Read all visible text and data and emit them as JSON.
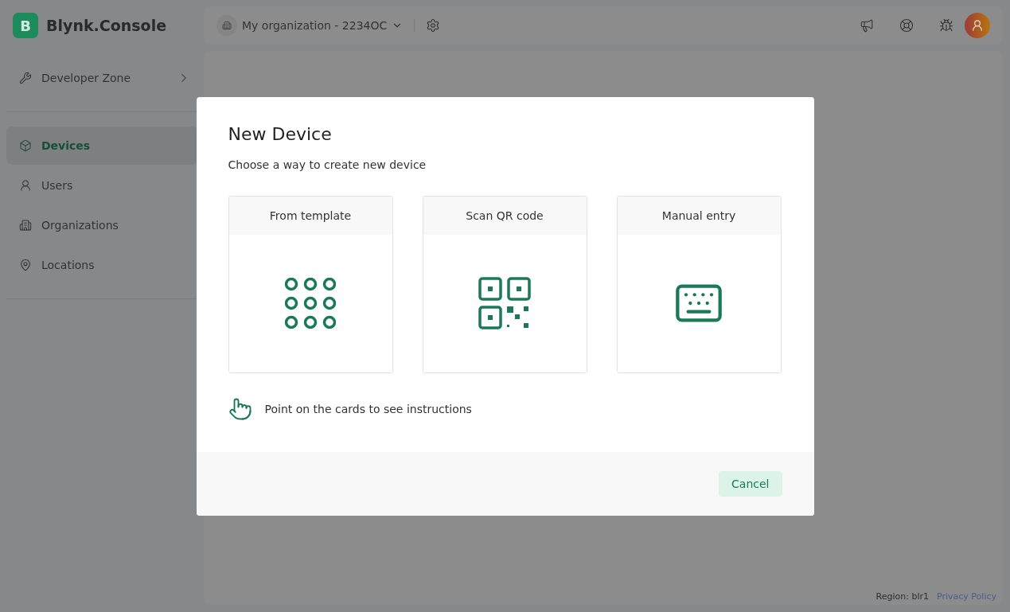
{
  "brand": {
    "logo_letter": "B",
    "name": "Blynk.Console"
  },
  "topbar": {
    "organization": "My organization - 2234OC"
  },
  "sidebar": {
    "developer_zone": "Developer Zone",
    "items": [
      {
        "label": "Devices",
        "kind": "devices",
        "selected": true
      },
      {
        "label": "Users",
        "kind": "users",
        "selected": false
      },
      {
        "label": "Organizations",
        "kind": "organizations",
        "selected": false
      },
      {
        "label": "Locations",
        "kind": "locations",
        "selected": false
      }
    ]
  },
  "dialog": {
    "title": "New Device",
    "subtitle": "Choose a way to create new device",
    "cards": [
      {
        "label": "From template",
        "kind": "template"
      },
      {
        "label": "Scan QR code",
        "kind": "qr"
      },
      {
        "label": "Manual entry",
        "kind": "manual"
      }
    ],
    "hint": "Point on the cards to see instructions",
    "cancel": "Cancel"
  },
  "footer": {
    "region": "Region: blr1",
    "privacy": "Privacy Policy"
  }
}
